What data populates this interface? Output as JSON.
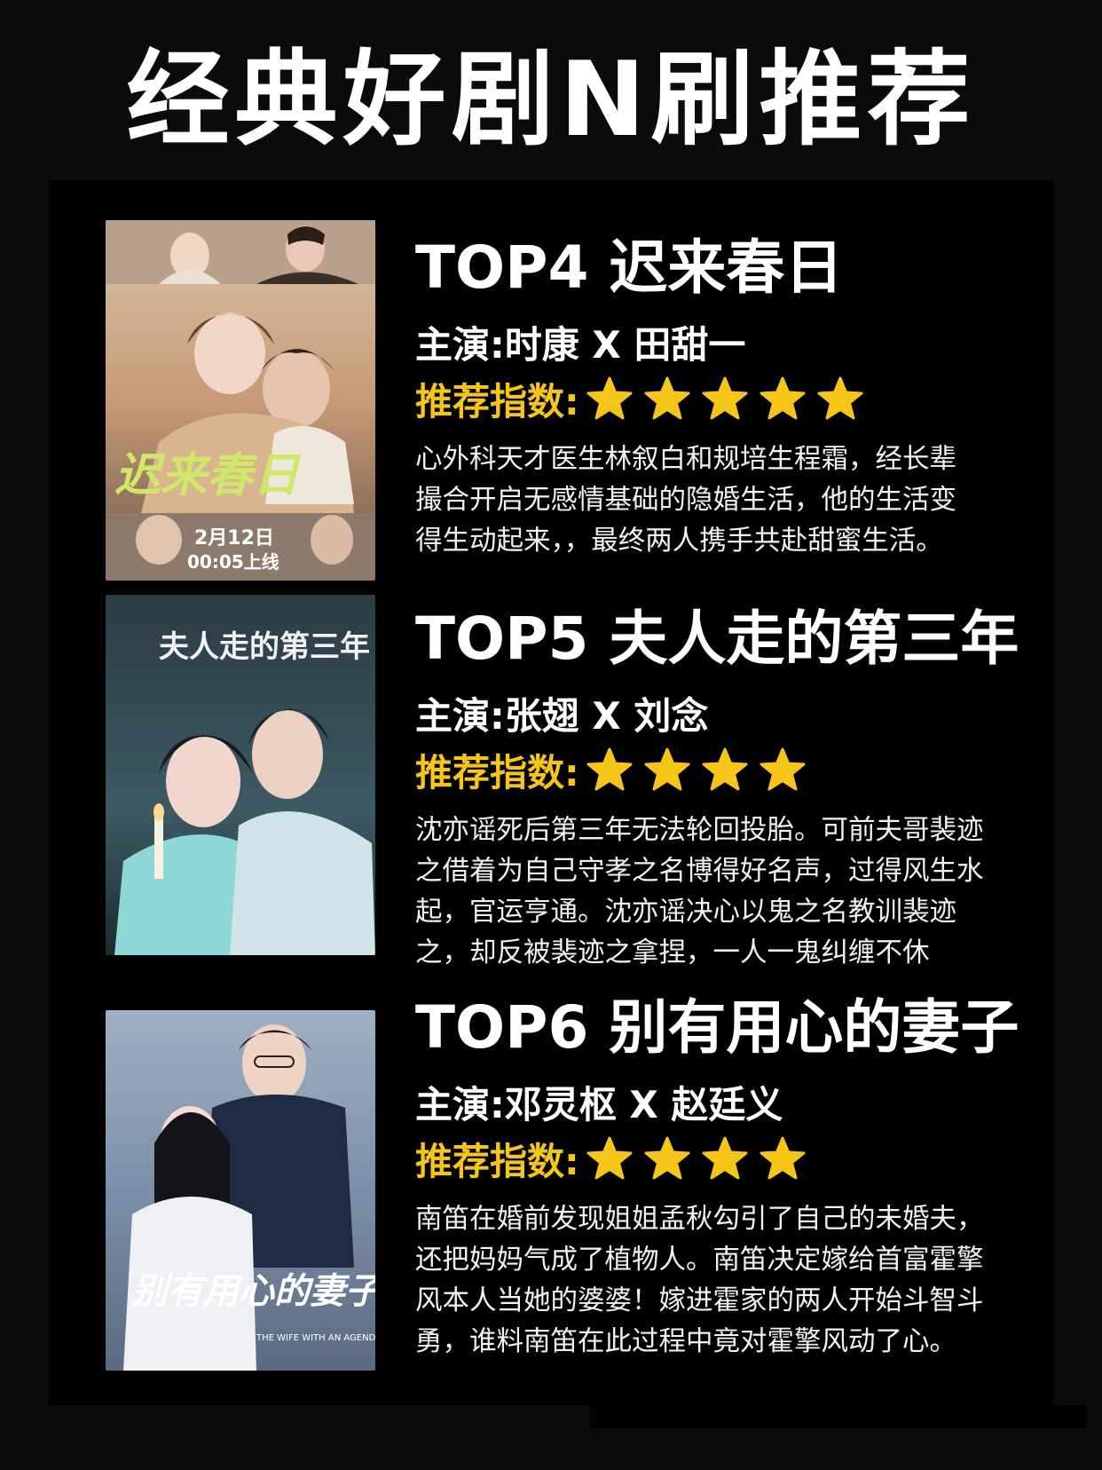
{
  "page_title": "经典好剧N刷推荐",
  "rating_label": "推荐指数:",
  "colors": {
    "accent": "#f5c518",
    "background": "#0b0b0b",
    "panel": "#000000"
  },
  "items": [
    {
      "title": "TOP4 迟来春日",
      "cast": "主演:时康 X 田甜一",
      "stars": 5,
      "poster": {
        "title_art": "迟来春日",
        "date_line1": "2月12日",
        "date_line2": "00:05上线"
      },
      "desc": [
        "心外科天才医生林叙白和规培生程霜，经长辈",
        "撮合开启无感情基础的隐婚生活，他的生活变",
        "得生动起来，，最终两人携手共赴甜蜜生活。"
      ]
    },
    {
      "title": "TOP5 夫人走的第三年",
      "cast": "主演:张翅 X 刘念",
      "stars": 4,
      "poster": {
        "title_art": "夫人走的第三年"
      },
      "desc": [
        "沈亦谣死后第三年无法轮回投胎。可前夫哥裴迹",
        "之借着为自己守孝之名博得好名声，过得风生水",
        "起，官运亨通。沈亦谣决心以鬼之名教训裴迹",
        "之，却反被裴迹之拿捏，一人一鬼纠缠不休"
      ]
    },
    {
      "title": "TOP6 别有用心的妻子",
      "cast": "主演:邓灵枢 X 赵廷义",
      "stars": 4,
      "poster": {
        "title_art": "别有用心的妻子",
        "english": "THE WIFE WITH AN AGENDA"
      },
      "desc": [
        "南笛在婚前发现姐姐孟秋勾引了自己的未婚夫，",
        "还把妈妈气成了植物人。南笛决定嫁给首富霍擎",
        "风本人当她的婆婆！嫁进霍家的两人开始斗智斗",
        "勇，谁料南笛在此过程中竟对霍擎风动了心。"
      ]
    }
  ]
}
